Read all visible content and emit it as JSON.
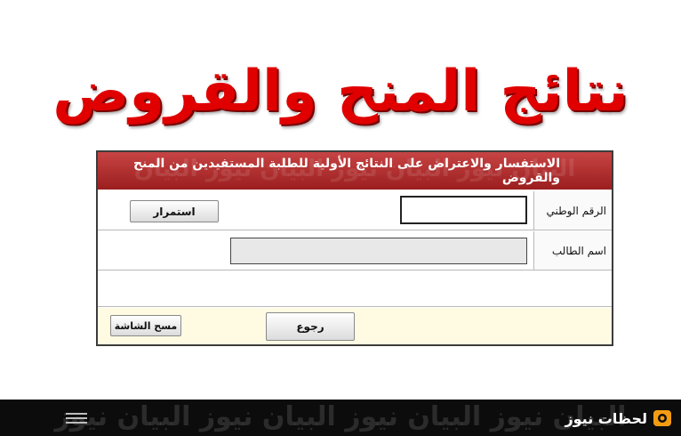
{
  "page": {
    "title": "نتائج المنح والقروض"
  },
  "form": {
    "header": "الاستفسار والاعتراض على النتائج الأولية للطلبة المستفيدين من المنح والقروض",
    "header_watermark": "البيان نيوز البيان نيوز البيان نيوز البيان",
    "national_id_label": "الرقم الوطني",
    "national_id_value": "",
    "continue_label": "استمرار",
    "student_name_label": "اسم الطالب",
    "student_name_value": "",
    "back_label": "رجوع",
    "clear_label": "مسح الشاشة"
  },
  "footer": {
    "watermark": "البيان نيوز البيان نيوز البيان نيوز البيان نيوز",
    "menu_icon": "menu-icon",
    "brand_name": "لحظات نيوز",
    "brand_icon": "brand-logo-icon",
    "brand_color": "#f39c12"
  },
  "colors": {
    "title_red": "#e00000",
    "header_red": "#b03030",
    "footer_bg": "#0c0c0c",
    "action_row_bg": "#fffbe3"
  }
}
